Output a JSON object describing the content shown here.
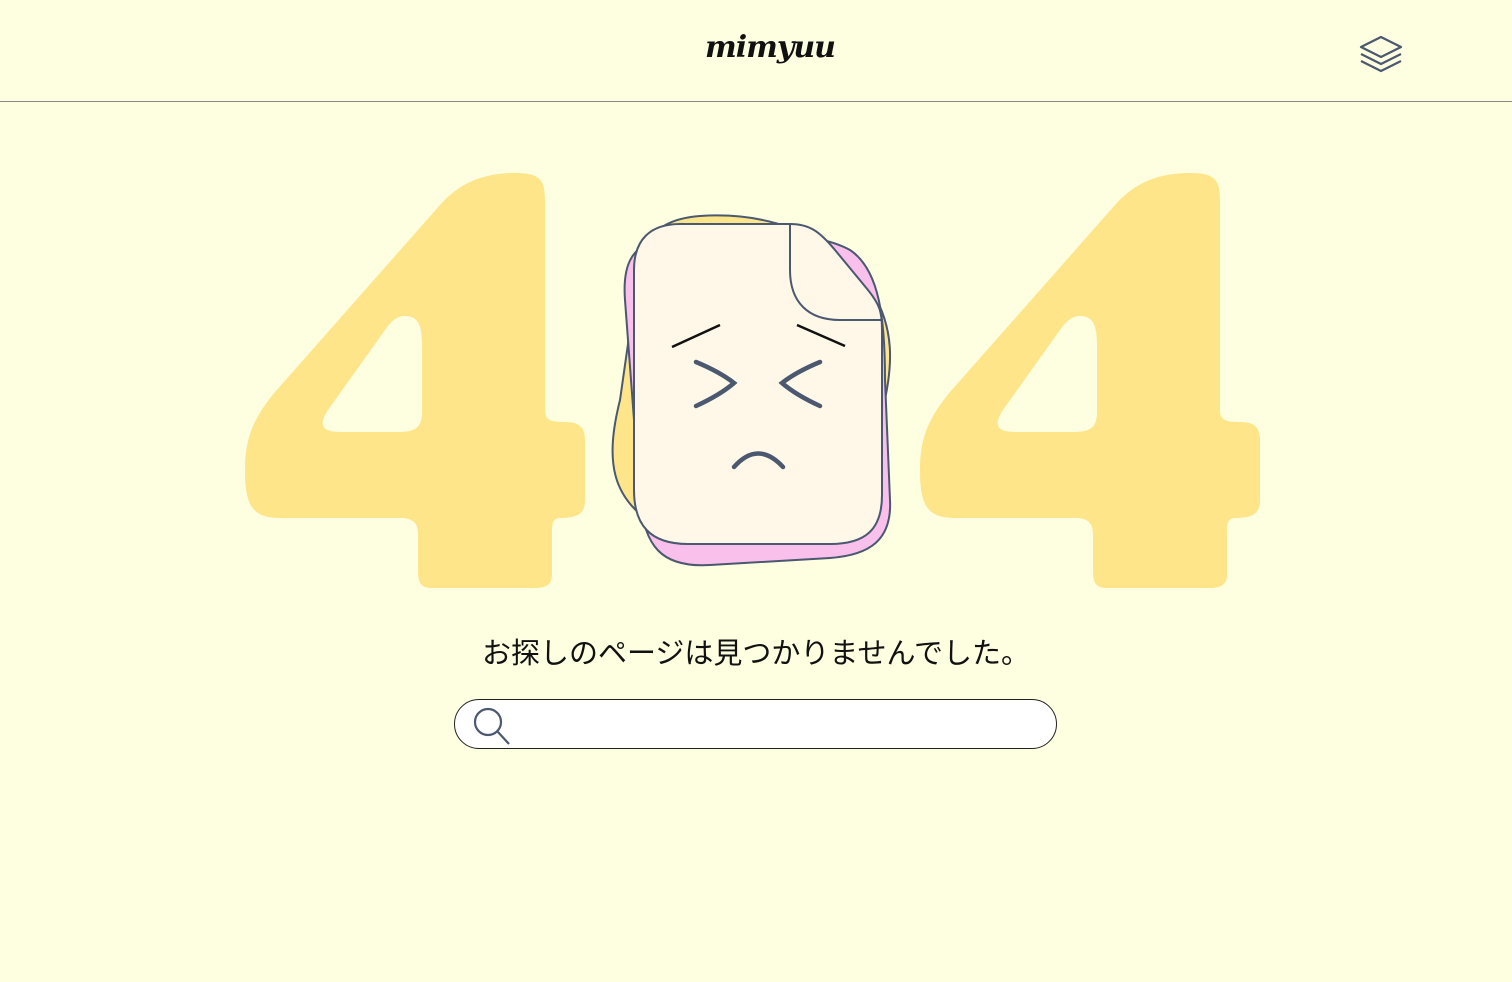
{
  "header": {
    "logo": "mimyuu",
    "menu_icon": "layers-icon"
  },
  "error": {
    "code": "404",
    "message": "お探しのページは見つかりませんでした。"
  },
  "search": {
    "value": "",
    "placeholder": "",
    "icon": "search-icon"
  },
  "colors": {
    "background": "#fefee0",
    "digit": "#ffe58a",
    "paper": "#fff8e8",
    "pink": "#f9c0ec",
    "stroke": "#4a5870"
  }
}
